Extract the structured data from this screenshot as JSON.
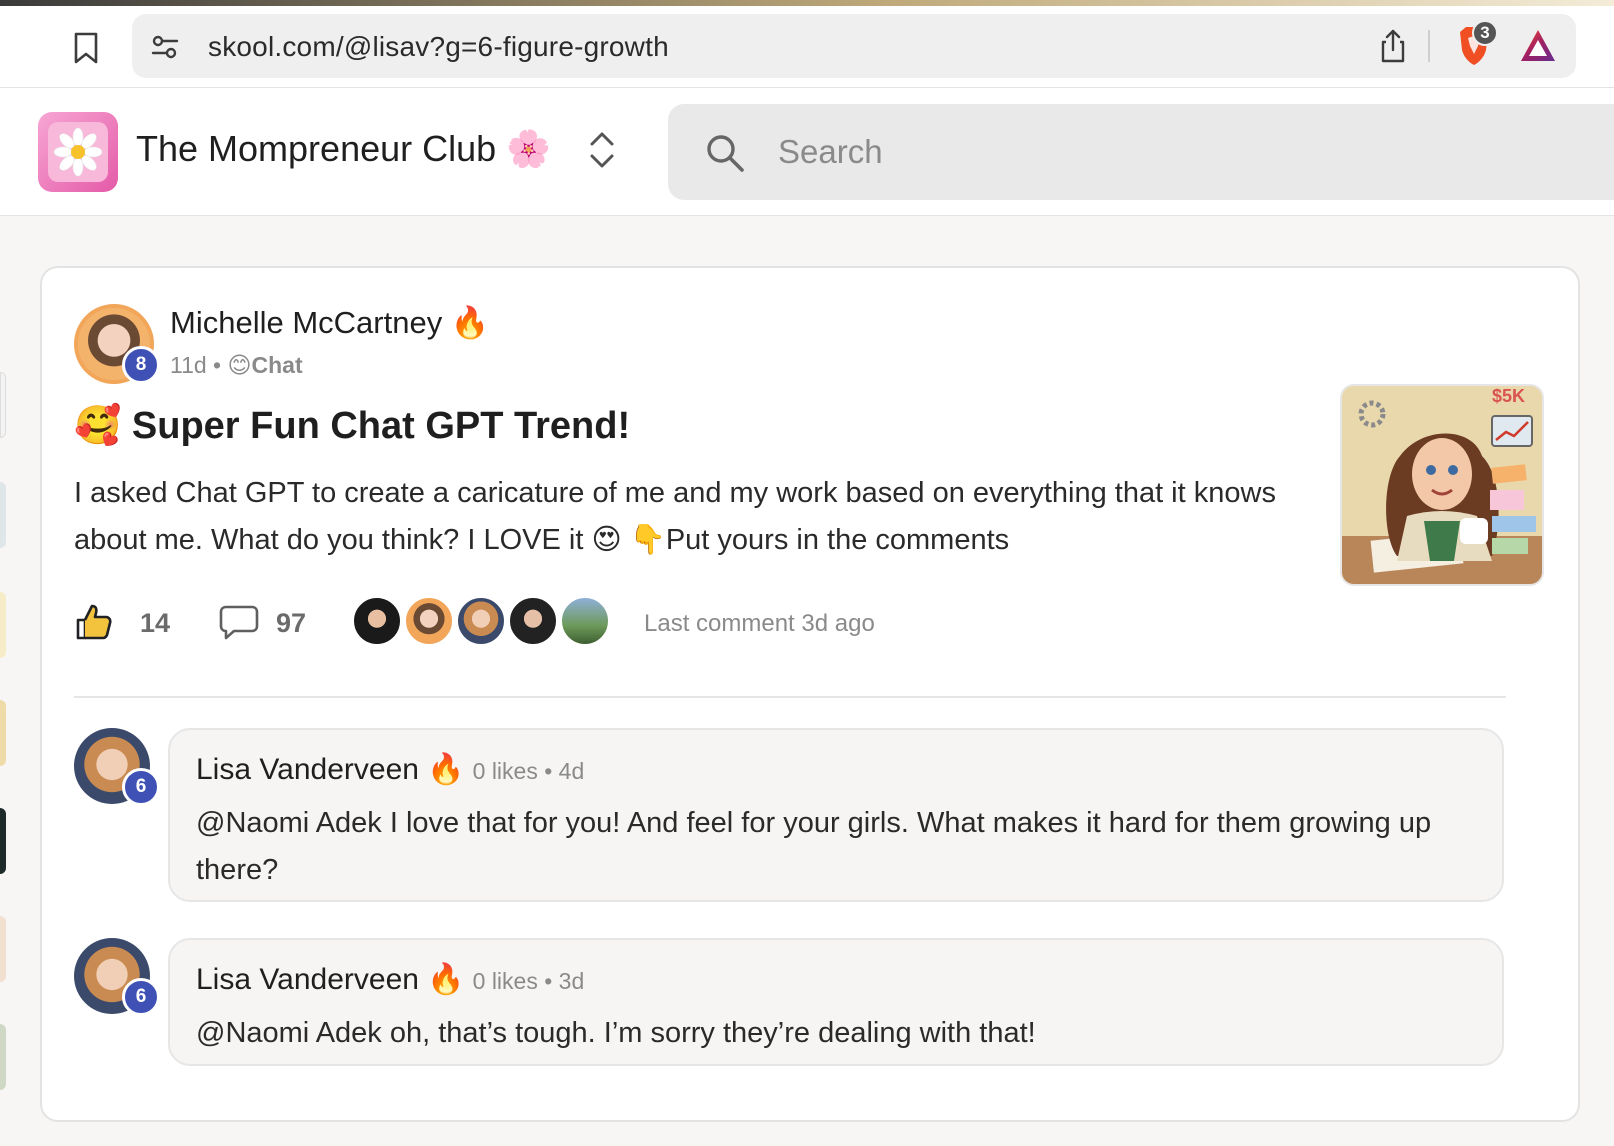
{
  "browser": {
    "url": "skool.com/@lisav?g=6-figure-growth",
    "brave_badge_count": "3"
  },
  "header": {
    "group_name": "The Mompreneur Club",
    "group_emoji": "🌸",
    "search_placeholder": "Search"
  },
  "post": {
    "author": "Michelle McCartney",
    "author_flair": "🔥",
    "author_level": "8",
    "time": "11d",
    "separator": " • ",
    "category_emoji": "😊",
    "category": "Chat",
    "title_emoji": "🥰",
    "title": "Super Fun Chat GPT Trend!",
    "body": "I asked Chat GPT to create a caricature of me and my work based on everything that it knows about me. What do you think? I LOVE it 😍  👇Put yours in the comments",
    "likes": "14",
    "comments": "97",
    "last_comment": "Last comment 3d ago",
    "thumbnail_icon": "caricature-image"
  },
  "comments": [
    {
      "author": "Lisa Vanderveen",
      "flair": "🔥",
      "level": "6",
      "meta": "0 likes • 4d",
      "text": "@Naomi Adek I love that for you! And feel for your girls. What makes it hard for them growing up there?"
    },
    {
      "author": "Lisa Vanderveen",
      "flair": "🔥",
      "level": "6",
      "meta": "0 likes • 3d",
      "text": "@Naomi Adek oh, that’s tough. I’m sorry they’re dealing with that!"
    }
  ],
  "colors": {
    "level_badge": "#3f51b5",
    "card_bg": "#ffffff",
    "page_bg": "#f7f6f4",
    "accent_pink": "#e45aa8"
  }
}
